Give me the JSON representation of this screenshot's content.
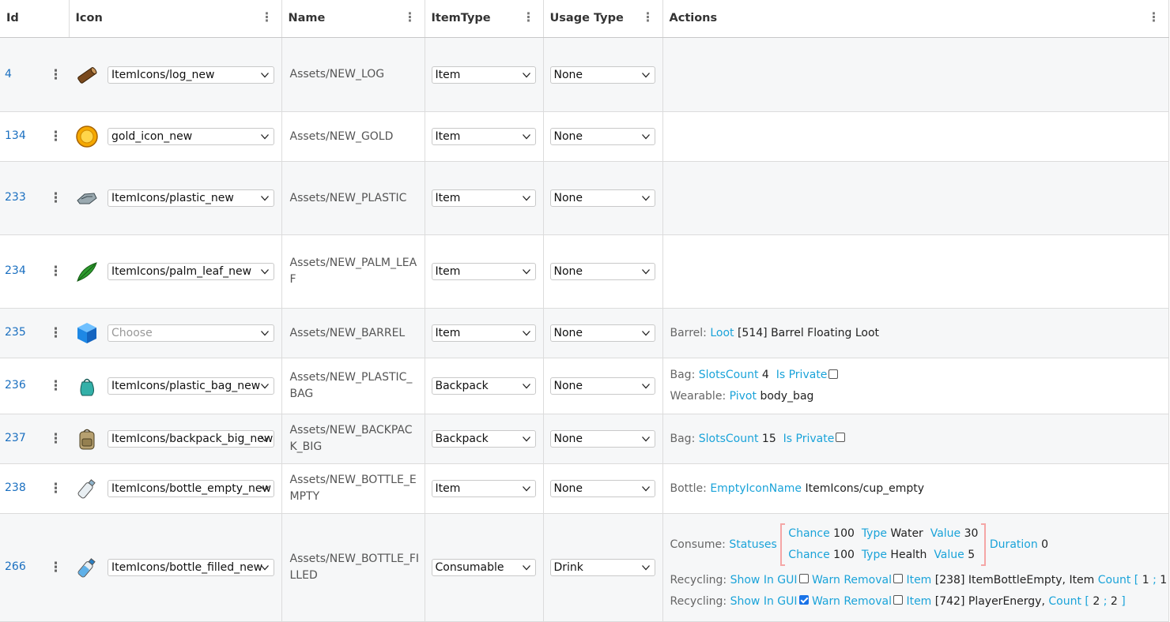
{
  "columns": [
    {
      "label": "Id"
    },
    {
      "label": "Icon"
    },
    {
      "label": "Name"
    },
    {
      "label": "ItemType"
    },
    {
      "label": "Usage Type"
    },
    {
      "label": "Actions"
    }
  ],
  "rows": [
    {
      "id": "4",
      "icon_select": "ItemIcons/log_new",
      "icon": "log-icon",
      "name": "Assets/NEW_LOG",
      "item_type": "Item",
      "usage_type": "None"
    },
    {
      "id": "134",
      "icon_select": "gold_icon_new",
      "icon": "gold-coin-icon",
      "name": "Assets/NEW_GOLD",
      "item_type": "Item",
      "usage_type": "None"
    },
    {
      "id": "233",
      "icon_select": "ItemIcons/plastic_new",
      "icon": "plastic-icon",
      "name": "Assets/NEW_PLASTIC",
      "item_type": "Item",
      "usage_type": "None"
    },
    {
      "id": "234",
      "icon_select": "ItemIcons/palm_leaf_new",
      "icon": "palm-leaf-icon",
      "name": "Assets/NEW_PALM_LEAF",
      "item_type": "Item",
      "usage_type": "None"
    },
    {
      "id": "235",
      "icon_select": "Choose",
      "icon": "cube-icon",
      "name": "Assets/NEW_BARREL",
      "item_type": "Item",
      "usage_type": "None",
      "action": {
        "label": "Barrel:",
        "key1": "Loot",
        "val1": "[514] Barrel Floating Loot"
      }
    },
    {
      "id": "236",
      "icon_select": "ItemIcons/plastic_bag_new",
      "icon": "plastic-bag-icon",
      "name": "Assets/NEW_PLASTIC_BAG",
      "item_type": "Backpack",
      "usage_type": "None",
      "action": {
        "label": "Bag:",
        "key1": "SlotsCount",
        "val1": "4",
        "key2": "Is Private",
        "label2": "Wearable:",
        "key3": "Pivot",
        "val3": "body_bag"
      }
    },
    {
      "id": "237",
      "icon_select": "ItemIcons/backpack_big_new",
      "icon": "backpack-icon",
      "name": "Assets/NEW_BACKPACK_BIG",
      "item_type": "Backpack",
      "usage_type": "None",
      "action": {
        "label": "Bag:",
        "key1": "SlotsCount",
        "val1": "15",
        "key2": "Is Private"
      }
    },
    {
      "id": "238",
      "icon_select": "ItemIcons/bottle_empty_new",
      "icon": "empty-bottle-icon",
      "name": "Assets/NEW_BOTTLE_EMPTY",
      "item_type": "Item",
      "usage_type": "None",
      "action": {
        "label": "Bottle:",
        "key1": "EmptyIconName",
        "val1": "ItemIcons/cup_empty"
      }
    },
    {
      "id": "266",
      "icon_select": "ItemIcons/bottle_filled_new",
      "icon": "filled-bottle-icon",
      "name": "Assets/NEW_BOTTLE_FILLED",
      "item_type": "Consumable",
      "usage_type": "Drink",
      "action": {
        "consume_label": "Consume:",
        "statuses_key": "Statuses",
        "statuses": [
          {
            "chance_key": "Chance",
            "chance": "100",
            "type_key": "Type",
            "type": "Water",
            "value_key": "Value",
            "value": "30"
          },
          {
            "chance_key": "Chance",
            "chance": "100",
            "type_key": "Type",
            "type": "Health",
            "value_key": "Value",
            "value": "5"
          }
        ],
        "duration_key": "Duration",
        "duration": "0",
        "recycling": [
          {
            "label": "Recycling:",
            "show_key": "Show In GUI",
            "show_checked": false,
            "warn_key": "Warn Removal",
            "item_key": "Item",
            "item_val": "[238] ItemBottleEmpty, Item",
            "count_key": "Count [",
            "c1": "1",
            "sep": ";",
            "c2": "1",
            "close": "]"
          },
          {
            "label": "Recycling:",
            "show_key": "Show In GUI",
            "show_checked": true,
            "warn_key": "Warn Removal",
            "item_key": "Item",
            "item_val": "[742] PlayerEnergy,",
            "count_key": "Count [",
            "c1": "2",
            "sep": ";",
            "c2": "2",
            "close": "]"
          }
        ]
      }
    }
  ]
}
